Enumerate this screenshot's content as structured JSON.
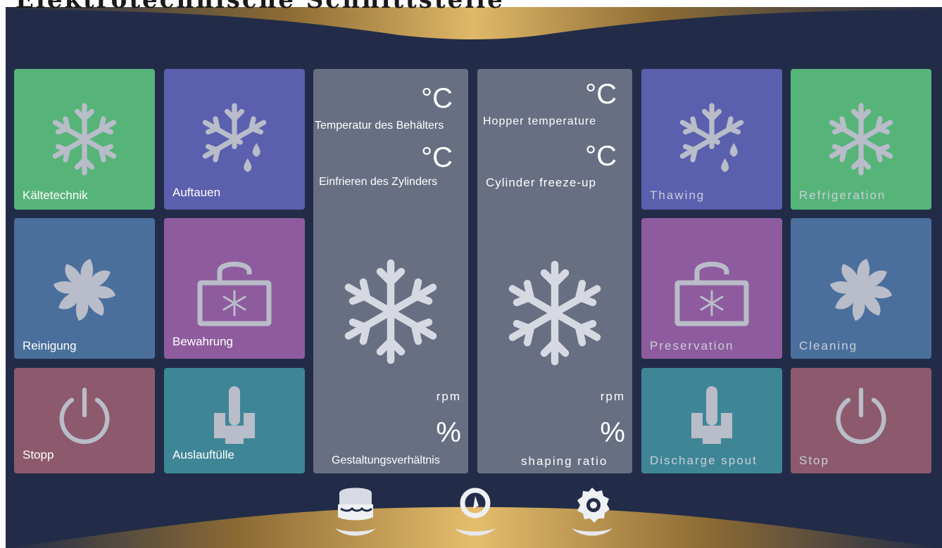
{
  "title": "Elektrotechnische Schnittstelle",
  "left_tiles": [
    {
      "label": "Kältetechnik"
    },
    {
      "label": "Auftauen"
    },
    {
      "label": "Reinigung"
    },
    {
      "label": "Bewahrung"
    },
    {
      "label": "Stopp"
    },
    {
      "label": "Auslauftülle"
    }
  ],
  "right_tiles": [
    {
      "label": "Thawing"
    },
    {
      "label": "Refrigeration"
    },
    {
      "label": "Preservation"
    },
    {
      "label": "Cleaning"
    },
    {
      "label": "Discharge spout"
    },
    {
      "label": "Stop"
    }
  ],
  "panel_de": {
    "temp_unit": "°C",
    "hopper_label": "Temperatur des Behälters",
    "cylinder_unit": "°C",
    "cylinder_label": "Einfrieren des Zylinders",
    "speed_unit": "rpm",
    "ratio_unit": "%",
    "ratio_label": "Gestaltungsverhältnis"
  },
  "panel_en": {
    "temp_unit": "°C",
    "hopper_label": "Hopper temperature",
    "cylinder_unit": "°C",
    "cylinder_label": "Cylinder freeze-up",
    "speed_unit": "rpm",
    "ratio_unit": "%",
    "ratio_label": "shaping ratio"
  },
  "bottom_nav": [
    "dessert-icon",
    "timer-icon",
    "settings-gear-icon"
  ],
  "colors": {
    "background": "#222c48",
    "gold_wave": "#c9a052",
    "green": "#56b478",
    "purple": "#5a5fae",
    "blue": "#4a6f9c",
    "magenta": "#8e5c9e",
    "rose": "#8c5a6c",
    "teal": "#3e8696",
    "panel": "#686f82",
    "icon": "#b9bcc9"
  }
}
